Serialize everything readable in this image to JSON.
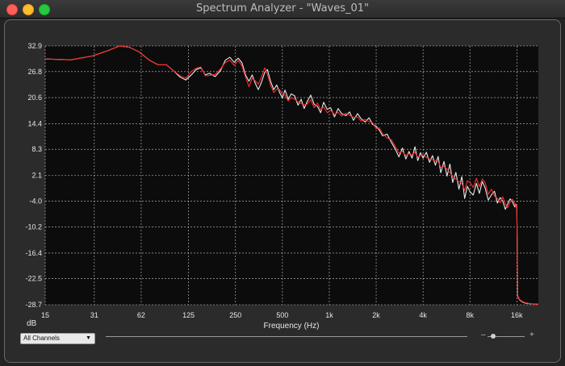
{
  "window": {
    "title": "Spectrum Analyzer - \"Waves_01\""
  },
  "controls": {
    "channel_select": "All Channels",
    "zoom_minus": "–",
    "zoom_plus": "+",
    "zoom_level": 0.1
  },
  "chart_data": {
    "type": "line",
    "xlabel": "Frequency (Hz)",
    "ylabel": "dB",
    "xscale": "log",
    "xlim": [
      15,
      22000
    ],
    "ylim": [
      -28.7,
      32.9
    ],
    "xticks": [
      {
        "v": 15,
        "label": "15"
      },
      {
        "v": 31,
        "label": "31"
      },
      {
        "v": 62,
        "label": "62"
      },
      {
        "v": 125,
        "label": "125"
      },
      {
        "v": 250,
        "label": "250"
      },
      {
        "v": 500,
        "label": "500"
      },
      {
        "v": 1000,
        "label": "1k"
      },
      {
        "v": 2000,
        "label": "2k"
      },
      {
        "v": 4000,
        "label": "4k"
      },
      {
        "v": 8000,
        "label": "8k"
      },
      {
        "v": 16000,
        "label": "16k"
      }
    ],
    "yticks": [
      32.9,
      26.8,
      20.6,
      14.4,
      8.3,
      2.1,
      -4.0,
      -10.2,
      -16.4,
      -22.5,
      -28.7
    ],
    "grid": true,
    "background": "#0c0c0c",
    "series": [
      {
        "color": "#e8e8e8",
        "points": [
          [
            15,
            29.8
          ],
          [
            22,
            29.6
          ],
          [
            30,
            30.5
          ],
          [
            38,
            31.8
          ],
          [
            45,
            32.9
          ],
          [
            52,
            32.6
          ],
          [
            60,
            31.5
          ],
          [
            70,
            29.5
          ],
          [
            80,
            28.4
          ],
          [
            90,
            28.4
          ],
          [
            100,
            27.0
          ],
          [
            110,
            25.5
          ],
          [
            120,
            24.8
          ],
          [
            130,
            26.0
          ],
          [
            140,
            27.3
          ],
          [
            150,
            27.7
          ],
          [
            160,
            26.0
          ],
          [
            170,
            26.4
          ],
          [
            185,
            25.6
          ],
          [
            200,
            27.0
          ],
          [
            215,
            29.5
          ],
          [
            230,
            30.2
          ],
          [
            245,
            29.0
          ],
          [
            260,
            30.0
          ],
          [
            275,
            28.9
          ],
          [
            290,
            26.0
          ],
          [
            305,
            24.5
          ],
          [
            320,
            26.0
          ],
          [
            335,
            24.0
          ],
          [
            350,
            22.5
          ],
          [
            365,
            24.0
          ],
          [
            385,
            26.6
          ],
          [
            400,
            27.3
          ],
          [
            420,
            24.5
          ],
          [
            440,
            22.5
          ],
          [
            460,
            23.6
          ],
          [
            480,
            21.8
          ],
          [
            500,
            20.5
          ],
          [
            520,
            22.4
          ],
          [
            545,
            20.2
          ],
          [
            570,
            21.5
          ],
          [
            600,
            21.0
          ],
          [
            630,
            18.8
          ],
          [
            660,
            20.2
          ],
          [
            690,
            18.0
          ],
          [
            720,
            19.6
          ],
          [
            760,
            21.2
          ],
          [
            800,
            19.0
          ],
          [
            840,
            18.5
          ],
          [
            880,
            17.0
          ],
          [
            920,
            19.5
          ],
          [
            970,
            17.8
          ],
          [
            1020,
            18.2
          ],
          [
            1080,
            16.0
          ],
          [
            1140,
            18.0
          ],
          [
            1200,
            16.8
          ],
          [
            1280,
            16.3
          ],
          [
            1350,
            17.2
          ],
          [
            1430,
            15.2
          ],
          [
            1520,
            16.8
          ],
          [
            1600,
            15.6
          ],
          [
            1700,
            14.8
          ],
          [
            1800,
            15.8
          ],
          [
            1900,
            14.2
          ],
          [
            2000,
            13.8
          ],
          [
            2100,
            12.8
          ],
          [
            2200,
            11.5
          ],
          [
            2350,
            11.9
          ],
          [
            2500,
            10.0
          ],
          [
            2650,
            8.4
          ],
          [
            2800,
            6.5
          ],
          [
            2950,
            8.6
          ],
          [
            3100,
            6.0
          ],
          [
            3250,
            7.8
          ],
          [
            3400,
            6.2
          ],
          [
            3550,
            8.9
          ],
          [
            3700,
            5.6
          ],
          [
            3850,
            7.5
          ],
          [
            4000,
            6.2
          ],
          [
            4200,
            7.6
          ],
          [
            4400,
            5.2
          ],
          [
            4600,
            6.8
          ],
          [
            4800,
            4.5
          ],
          [
            5000,
            6.6
          ],
          [
            5200,
            2.7
          ],
          [
            5450,
            5.4
          ],
          [
            5700,
            1.9
          ],
          [
            5950,
            4.8
          ],
          [
            6200,
            0.4
          ],
          [
            6500,
            2.8
          ],
          [
            6800,
            -1.2
          ],
          [
            7100,
            1.8
          ],
          [
            7400,
            -3.4
          ],
          [
            7700,
            -0.5
          ],
          [
            8000,
            -1.8
          ],
          [
            8400,
            -2.6
          ],
          [
            8800,
            0.2
          ],
          [
            9200,
            -2.2
          ],
          [
            9600,
            0.6
          ],
          [
            10000,
            -0.8
          ],
          [
            10500,
            -3.8
          ],
          [
            11000,
            -2.5
          ],
          [
            11500,
            -1.7
          ],
          [
            12000,
            -4.5
          ],
          [
            12500,
            -3.2
          ],
          [
            13000,
            -4.0
          ],
          [
            13500,
            -6.0
          ],
          [
            14000,
            -4.6
          ],
          [
            14500,
            -3.5
          ],
          [
            15000,
            -4.2
          ],
          [
            15500,
            -5.4
          ],
          [
            15800,
            -4.8
          ],
          [
            16000,
            -5.3
          ],
          [
            16200,
            -26.7
          ],
          [
            16700,
            -27.6
          ],
          [
            17500,
            -28.1
          ],
          [
            18500,
            -28.4
          ],
          [
            20000,
            -28.5
          ],
          [
            22000,
            -28.6
          ]
        ]
      },
      {
        "color": "#ff2a2a",
        "points": [
          [
            15,
            29.8
          ],
          [
            22,
            29.6
          ],
          [
            30,
            30.5
          ],
          [
            38,
            31.8
          ],
          [
            45,
            32.9
          ],
          [
            52,
            32.6
          ],
          [
            60,
            31.5
          ],
          [
            70,
            29.5
          ],
          [
            80,
            28.4
          ],
          [
            90,
            28.4
          ],
          [
            100,
            27.0
          ],
          [
            110,
            25.8
          ],
          [
            120,
            25.2
          ],
          [
            130,
            26.8
          ],
          [
            140,
            27.6
          ],
          [
            150,
            27.9
          ],
          [
            160,
            25.8
          ],
          [
            170,
            25.9
          ],
          [
            185,
            26.1
          ],
          [
            200,
            27.4
          ],
          [
            215,
            29.0
          ],
          [
            230,
            29.5
          ],
          [
            245,
            28.3
          ],
          [
            260,
            29.4
          ],
          [
            275,
            28.2
          ],
          [
            290,
            25.5
          ],
          [
            305,
            23.2
          ],
          [
            320,
            25.2
          ],
          [
            335,
            24.6
          ],
          [
            350,
            23.8
          ],
          [
            365,
            25.3
          ],
          [
            385,
            27.7
          ],
          [
            400,
            26.2
          ],
          [
            420,
            23.6
          ],
          [
            440,
            21.8
          ],
          [
            460,
            22.6
          ],
          [
            480,
            22.5
          ],
          [
            500,
            21.4
          ],
          [
            520,
            21.2
          ],
          [
            545,
            19.8
          ],
          [
            570,
            20.6
          ],
          [
            600,
            20.2
          ],
          [
            630,
            19.6
          ],
          [
            660,
            19.2
          ],
          [
            690,
            18.9
          ],
          [
            720,
            19.0
          ],
          [
            760,
            20.1
          ],
          [
            800,
            18.2
          ],
          [
            840,
            19.3
          ],
          [
            880,
            17.7
          ],
          [
            920,
            18.4
          ],
          [
            970,
            17.0
          ],
          [
            1020,
            17.6
          ],
          [
            1080,
            16.6
          ],
          [
            1140,
            17.1
          ],
          [
            1200,
            16.2
          ],
          [
            1280,
            16.9
          ],
          [
            1350,
            16.4
          ],
          [
            1430,
            15.9
          ],
          [
            1520,
            16.0
          ],
          [
            1600,
            15.0
          ],
          [
            1700,
            15.4
          ],
          [
            1800,
            14.9
          ],
          [
            1900,
            14.6
          ],
          [
            2000,
            13.2
          ],
          [
            2100,
            13.4
          ],
          [
            2200,
            12.0
          ],
          [
            2350,
            11.0
          ],
          [
            2500,
            10.6
          ],
          [
            2650,
            9.0
          ],
          [
            2800,
            7.4
          ],
          [
            2950,
            7.8
          ],
          [
            3100,
            6.8
          ],
          [
            3250,
            7.2
          ],
          [
            3400,
            7.0
          ],
          [
            3550,
            7.6
          ],
          [
            3700,
            6.4
          ],
          [
            3850,
            6.8
          ],
          [
            4000,
            7.0
          ],
          [
            4200,
            6.4
          ],
          [
            4400,
            6.0
          ],
          [
            4600,
            5.8
          ],
          [
            4800,
            5.6
          ],
          [
            5000,
            5.4
          ],
          [
            5200,
            4.0
          ],
          [
            5450,
            4.2
          ],
          [
            5700,
            3.6
          ],
          [
            5950,
            2.8
          ],
          [
            6200,
            1.8
          ],
          [
            6500,
            1.2
          ],
          [
            6800,
            0.6
          ],
          [
            7100,
            0.2
          ],
          [
            7400,
            -1.5
          ],
          [
            7700,
            0.8
          ],
          [
            8000,
            0.4
          ],
          [
            8400,
            -0.8
          ],
          [
            8800,
            1.4
          ],
          [
            9200,
            -0.6
          ],
          [
            9600,
            1.2
          ],
          [
            10000,
            0.4
          ],
          [
            10500,
            -2.4
          ],
          [
            11000,
            -1.2
          ],
          [
            11500,
            -2.8
          ],
          [
            12000,
            -3.4
          ],
          [
            12500,
            -4.4
          ],
          [
            13000,
            -3.0
          ],
          [
            13500,
            -4.8
          ],
          [
            14000,
            -5.6
          ],
          [
            14500,
            -4.2
          ],
          [
            15000,
            -3.6
          ],
          [
            15500,
            -4.6
          ],
          [
            15800,
            -5.6
          ],
          [
            16000,
            -4.8
          ],
          [
            16200,
            -26.5
          ],
          [
            16700,
            -27.5
          ],
          [
            17500,
            -28.0
          ],
          [
            18500,
            -28.3
          ],
          [
            20000,
            -28.5
          ],
          [
            22000,
            -28.6
          ]
        ]
      }
    ]
  }
}
